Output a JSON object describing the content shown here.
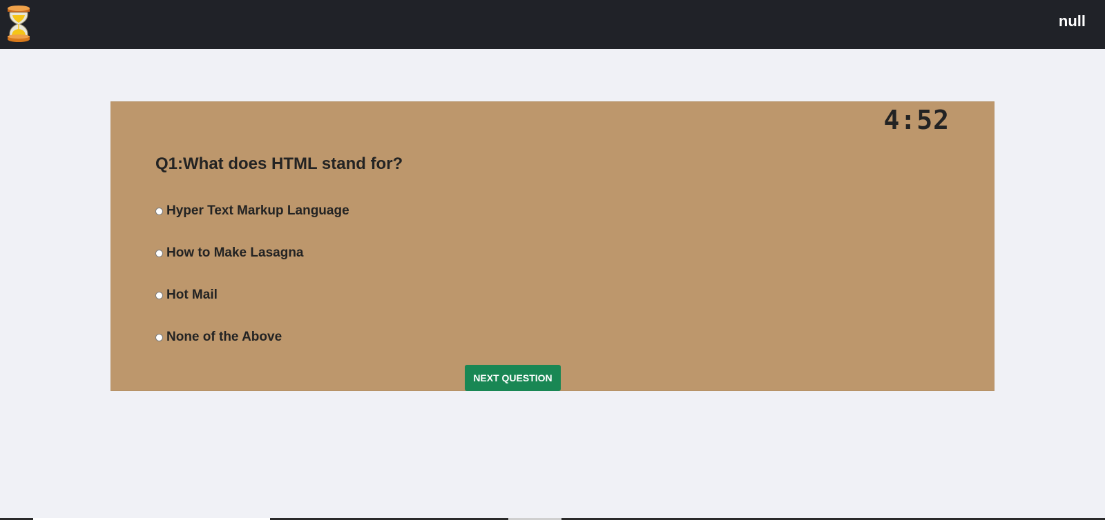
{
  "header": {
    "logo_icon": "hourglass-icon",
    "username": "null"
  },
  "quiz": {
    "timer": "4:52",
    "question": "Q1:What does HTML stand for?",
    "options": [
      "Hyper Text Markup Language",
      "How to Make Lasagna",
      "Hot Mail",
      "None of the Above"
    ],
    "next_label": "NEXT QUESTION"
  },
  "colors": {
    "topbar": "#202228",
    "page_bg": "#f0f1f6",
    "card_bg": "#bd976c",
    "button": "#198754"
  }
}
